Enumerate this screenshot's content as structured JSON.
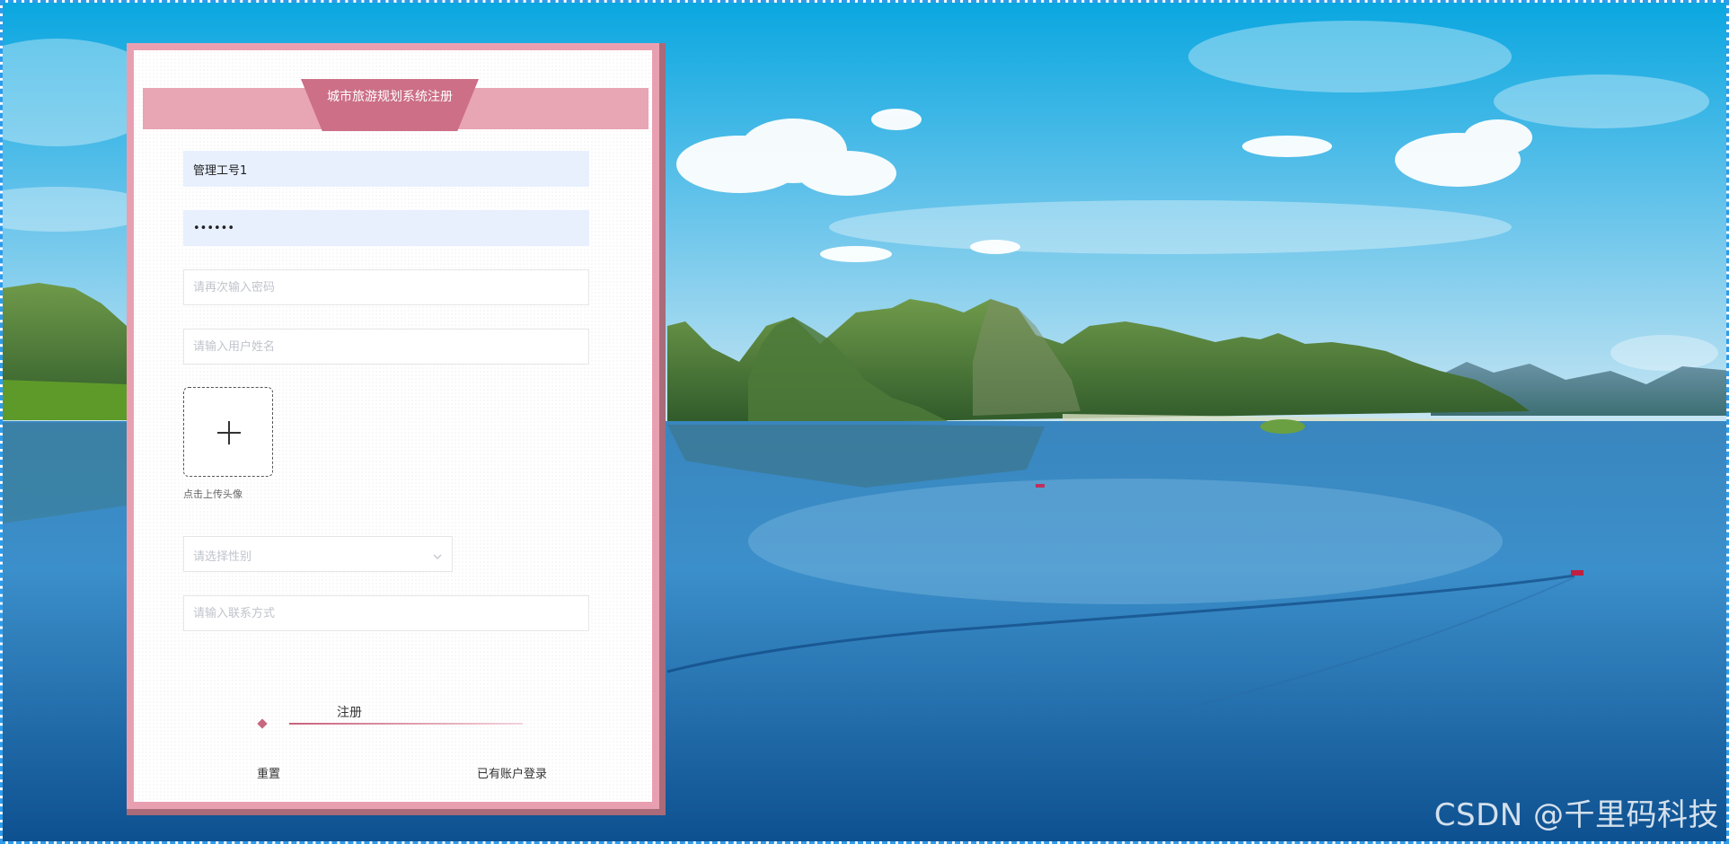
{
  "form": {
    "title": "城市旅游规划系统注册",
    "account_value": "管理工号1",
    "password_value": "••••••",
    "confirm_password_placeholder": "请再次输入密码",
    "username_placeholder": "请输入用户姓名",
    "upload_hint": "点击上传头像",
    "gender_placeholder": "请选择性别",
    "contact_placeholder": "请输入联系方式",
    "register_label": "注册",
    "reset_label": "重置",
    "login_link_label": "已有账户登录"
  },
  "icons": {
    "upload": "plus-icon",
    "select": "chevron-down-icon",
    "decor": "diamond-icon"
  },
  "colors": {
    "card_frame": "#e8a0b1",
    "title_tab": "#cc6f87",
    "accent_line": "#c8607a",
    "filled_field": "#e8f0fe"
  },
  "watermark": "CSDN @千里码科技"
}
